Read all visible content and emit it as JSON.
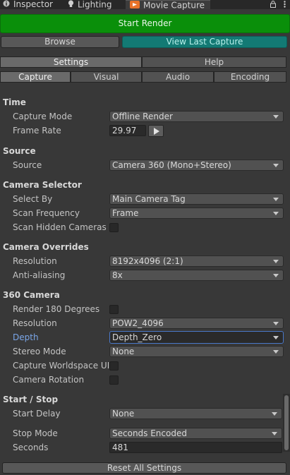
{
  "tabs": [
    {
      "label": "Inspector",
      "icon": "info-icon",
      "active": false
    },
    {
      "label": "Lighting",
      "icon": "lightbulb-icon",
      "active": false
    },
    {
      "label": "Movie Capture",
      "icon": "movie-capture-icon",
      "active": true
    }
  ],
  "window_icons": {
    "lock": "lock-icon",
    "menu": "kebab-menu-icon"
  },
  "actions": {
    "start_render": "Start Render",
    "browse": "Browse",
    "view_last_capture": "View Last Capture",
    "reset_all": "Reset All Settings"
  },
  "top_tabs": {
    "settings": "Settings",
    "help": "Help"
  },
  "sub_tabs": [
    "Capture",
    "Visual",
    "Audio",
    "Encoding"
  ],
  "sections": {
    "time": {
      "title": "Time",
      "capture_mode_label": "Capture Mode",
      "capture_mode_value": "Offline Render",
      "frame_rate_label": "Frame Rate",
      "frame_rate_value": "29.97"
    },
    "source": {
      "title": "Source",
      "source_label": "Source",
      "source_value": "Camera 360 (Mono+Stereo)"
    },
    "camera_selector": {
      "title": "Camera Selector",
      "select_by_label": "Select By",
      "select_by_value": "Main Camera Tag",
      "scan_frequency_label": "Scan Frequency",
      "scan_frequency_value": "Frame",
      "scan_hidden_label": "Scan Hidden Cameras",
      "scan_hidden_checked": false
    },
    "camera_overrides": {
      "title": "Camera Overrides",
      "resolution_label": "Resolution",
      "resolution_value": "8192x4096 (2:1)",
      "antialiasing_label": "Anti-aliasing",
      "antialiasing_value": "8x"
    },
    "camera_360": {
      "title": "360 Camera",
      "render180_label": "Render 180 Degrees",
      "render180_checked": false,
      "resolution_label": "Resolution",
      "resolution_value": "POW2_4096",
      "depth_label": "Depth",
      "depth_value": "Depth_Zero",
      "stereo_mode_label": "Stereo Mode",
      "stereo_mode_value": "None",
      "capture_ui_label": "Capture Worldspace UI",
      "capture_ui_checked": false,
      "camera_rotation_label": "Camera Rotation",
      "camera_rotation_checked": false
    },
    "start_stop": {
      "title": "Start / Stop",
      "start_delay_label": "Start Delay",
      "start_delay_value": "None",
      "stop_mode_label": "Stop Mode",
      "stop_mode_value": "Seconds Encoded",
      "seconds_label": "Seconds",
      "seconds_value": "481"
    }
  },
  "colors": {
    "start_render": "#0a8f0a",
    "view_last_capture": "#137a74",
    "focus_label": "#7aa6e8",
    "background": "#383838"
  }
}
